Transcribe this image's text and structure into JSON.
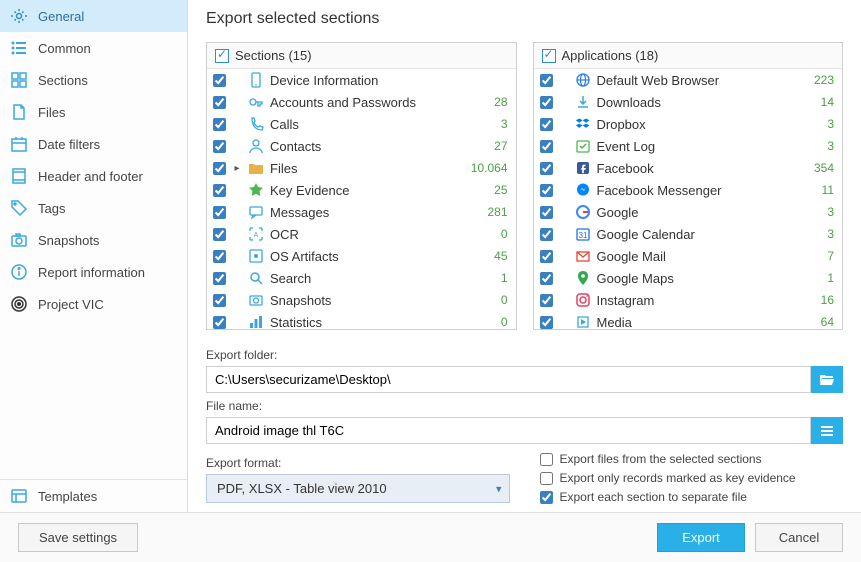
{
  "title": "Export selected sections",
  "sidebar": {
    "items": [
      {
        "id": "general",
        "label": "General",
        "icon": "gear",
        "active": true
      },
      {
        "id": "common",
        "label": "Common",
        "icon": "list"
      },
      {
        "id": "sections",
        "label": "Sections",
        "icon": "grid"
      },
      {
        "id": "files",
        "label": "Files",
        "icon": "doc"
      },
      {
        "id": "date-filters",
        "label": "Date filters",
        "icon": "calendar"
      },
      {
        "id": "header-footer",
        "label": "Header and footer",
        "icon": "hf"
      },
      {
        "id": "tags",
        "label": "Tags",
        "icon": "tag"
      },
      {
        "id": "snapshots",
        "label": "Snapshots",
        "icon": "camera"
      },
      {
        "id": "report-info",
        "label": "Report information",
        "icon": "info"
      },
      {
        "id": "project-vic",
        "label": "Project VIC",
        "icon": "target"
      }
    ],
    "templates_label": "Templates"
  },
  "sections_panel": {
    "header": "Sections (15)",
    "items": [
      {
        "label": "Device Information",
        "count": "",
        "icon": "device",
        "color": "#3aa8dd"
      },
      {
        "label": "Accounts and Passwords",
        "count": "28",
        "icon": "key",
        "color": "#3aa8dd"
      },
      {
        "label": "Calls",
        "count": "3",
        "icon": "phone",
        "color": "#3aa8dd"
      },
      {
        "label": "Contacts",
        "count": "27",
        "icon": "person",
        "color": "#3aa8dd"
      },
      {
        "label": "Files",
        "count": "10.064",
        "icon": "folder",
        "color": "#e8b048",
        "expand": true
      },
      {
        "label": "Key Evidence",
        "count": "25",
        "icon": "star",
        "color": "#4cb84c"
      },
      {
        "label": "Messages",
        "count": "281",
        "icon": "msg",
        "color": "#3aa8dd"
      },
      {
        "label": "OCR",
        "count": "0",
        "icon": "ocr",
        "color": "#3aa8dd"
      },
      {
        "label": "OS Artifacts",
        "count": "45",
        "icon": "os",
        "color": "#3aa8dd"
      },
      {
        "label": "Search",
        "count": "1",
        "icon": "search",
        "color": "#3aa8dd"
      },
      {
        "label": "Snapshots",
        "count": "0",
        "icon": "camera",
        "color": "#3aa8dd"
      },
      {
        "label": "Statistics",
        "count": "0",
        "icon": "stats",
        "color": "#3aa8dd"
      }
    ]
  },
  "apps_panel": {
    "header": "Applications (18)",
    "items": [
      {
        "label": "Default Web Browser",
        "count": "223",
        "icon": "globe",
        "color": "#2b7de9"
      },
      {
        "label": "Downloads",
        "count": "14",
        "icon": "download",
        "color": "#3aa8dd"
      },
      {
        "label": "Dropbox",
        "count": "3",
        "icon": "dropbox",
        "color": "#007ee5"
      },
      {
        "label": "Event Log",
        "count": "3",
        "icon": "event",
        "color": "#4cb84c"
      },
      {
        "label": "Facebook",
        "count": "354",
        "icon": "fb",
        "color": "#3b5998"
      },
      {
        "label": "Facebook Messenger",
        "count": "11",
        "icon": "fbm",
        "color": "#0084ff"
      },
      {
        "label": "Google",
        "count": "3",
        "icon": "google",
        "color": "#4285f4"
      },
      {
        "label": "Google Calendar",
        "count": "3",
        "icon": "gcal",
        "color": "#1a73e8"
      },
      {
        "label": "Google Mail",
        "count": "7",
        "icon": "gmail",
        "color": "#ea4335"
      },
      {
        "label": "Google Maps",
        "count": "1",
        "icon": "gmaps",
        "color": "#34a853"
      },
      {
        "label": "Instagram",
        "count": "16",
        "icon": "ig",
        "color": "#e4405f"
      },
      {
        "label": "Media",
        "count": "64",
        "icon": "media",
        "color": "#3aa8dd"
      }
    ]
  },
  "form": {
    "export_folder_label": "Export folder:",
    "export_folder_value": "C:\\Users\\securizame\\Desktop\\",
    "file_name_label": "File name:",
    "file_name_value": "Android image thl T6C",
    "export_format_label": "Export format:",
    "export_format_value": "PDF, XLSX - Table view 2010",
    "opt_files": "Export files from the selected sections",
    "opt_keyev": "Export only records marked as key evidence",
    "opt_separate": "Export each section to separate file"
  },
  "footer": {
    "save_settings": "Save settings",
    "export": "Export",
    "cancel": "Cancel"
  }
}
